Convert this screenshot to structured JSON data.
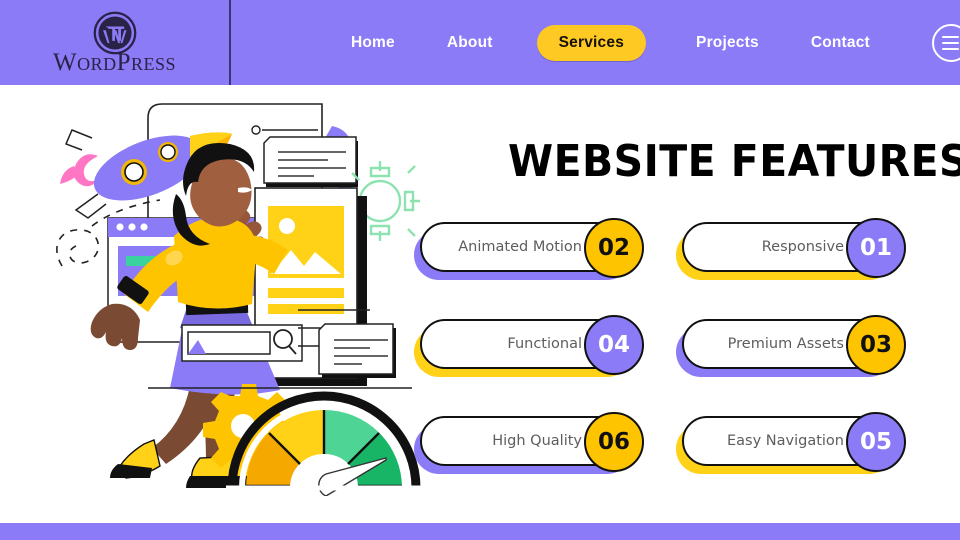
{
  "header": {
    "brand": {
      "name": "WordPress",
      "logo_icon": "wordpress-logo-icon"
    },
    "nav": [
      {
        "label": "Home",
        "active": false
      },
      {
        "label": "About",
        "active": false
      },
      {
        "label": "Services",
        "active": true
      },
      {
        "label": "Projects",
        "active": false
      },
      {
        "label": "Contact",
        "active": false
      }
    ],
    "menu_icon": "hamburger-menu-icon"
  },
  "main": {
    "title": "WEBSITE FEATURES",
    "features": [
      {
        "label": "Animated Motion",
        "number": "02",
        "badge_color": "yellow",
        "shadow_color": "purple"
      },
      {
        "label": "Responsive",
        "number": "01",
        "badge_color": "purple",
        "shadow_color": "yellow"
      },
      {
        "label": "Functional",
        "number": "04",
        "badge_color": "purple",
        "shadow_color": "yellow"
      },
      {
        "label": "Premium Assets",
        "number": "03",
        "badge_color": "yellow",
        "shadow_color": "purple"
      },
      {
        "label": "High Quality",
        "number": "06",
        "badge_color": "yellow",
        "shadow_color": "purple"
      },
      {
        "label": "Easy Navigation",
        "number": "05",
        "badge_color": "purple",
        "shadow_color": "yellow"
      }
    ]
  },
  "illustration": {
    "name": "website-features-illustration",
    "elements": [
      "rocket-icon",
      "person-figure",
      "browser-window",
      "image-document-card",
      "note-card",
      "search-bar",
      "gear-icon",
      "speedometer-gauge"
    ]
  },
  "colors": {
    "brand_purple": "#8c7bf7",
    "accent_yellow": "#ffc400",
    "outline_black": "#111111",
    "label_gray": "#5d5d5d",
    "page_background": "#ffffff"
  }
}
